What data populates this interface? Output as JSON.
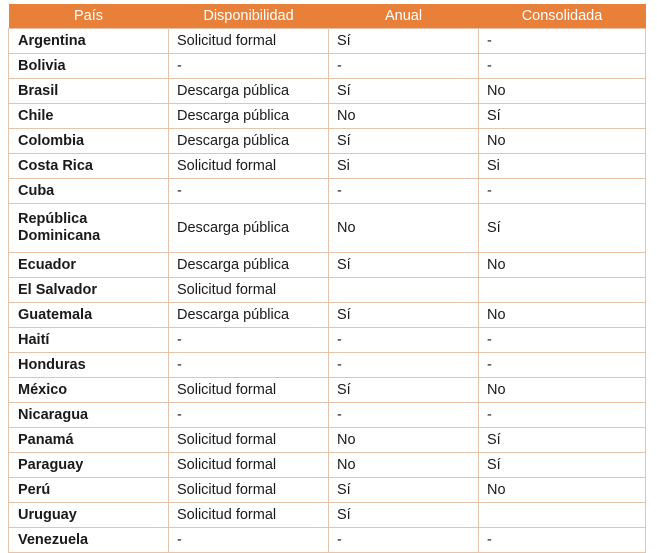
{
  "theme": {
    "header_bg": "#E8803A",
    "header_text": "#FFFFFF",
    "border": "#E6C3AB",
    "body_text": "#1A1A1A",
    "page_bg": "#FFFFFF"
  },
  "table": {
    "columns": [
      "País",
      "Disponibilidad",
      "Anual",
      "Consolidada"
    ],
    "rows": [
      {
        "pais": "Argentina",
        "disponibilidad": "Solicitud formal",
        "anual": "Sí",
        "consolidada": "-"
      },
      {
        "pais": "Bolivia",
        "disponibilidad": "-",
        "anual": "-",
        "consolidada": "-"
      },
      {
        "pais": "Brasil",
        "disponibilidad": "Descarga pública",
        "anual": "Sí",
        "consolidada": "No"
      },
      {
        "pais": "Chile",
        "disponibilidad": "Descarga pública",
        "anual": "No",
        "consolidada": "Sí"
      },
      {
        "pais": "Colombia",
        "disponibilidad": "Descarga pública",
        "anual": "Sí",
        "consolidada": "No"
      },
      {
        "pais": "Costa Rica",
        "disponibilidad": "Solicitud formal",
        "anual": "Si",
        "consolidada": "Si"
      },
      {
        "pais": "Cuba",
        "disponibilidad": "-",
        "anual": "-",
        "consolidada": "-"
      },
      {
        "pais": "República Dominicana",
        "disponibilidad": "Descarga pública",
        "anual": "No",
        "consolidada": "Sí",
        "tall": true
      },
      {
        "pais": "Ecuador",
        "disponibilidad": "Descarga pública",
        "anual": "Sí",
        "consolidada": "No"
      },
      {
        "pais": "El Salvador",
        "disponibilidad": "Solicitud formal",
        "anual": "",
        "consolidada": ""
      },
      {
        "pais": "Guatemala",
        "disponibilidad": "Descarga pública",
        "anual": "Sí",
        "consolidada": "No"
      },
      {
        "pais": "Haití",
        "disponibilidad": "-",
        "anual": "-",
        "consolidada": "-"
      },
      {
        "pais": "Honduras",
        "disponibilidad": "-",
        "anual": "-",
        "consolidada": "-"
      },
      {
        "pais": "México",
        "disponibilidad": "Solicitud formal",
        "anual": "Sí",
        "consolidada": "No"
      },
      {
        "pais": "Nicaragua",
        "disponibilidad": "-",
        "anual": "-",
        "consolidada": "-"
      },
      {
        "pais": "Panamá",
        "disponibilidad": "Solicitud formal",
        "anual": "No",
        "consolidada": "Sí"
      },
      {
        "pais": "Paraguay",
        "disponibilidad": "Solicitud formal",
        "anual": "No",
        "consolidada": "Sí"
      },
      {
        "pais": "Perú",
        "disponibilidad": "Solicitud formal",
        "anual": "Sí",
        "consolidada": "No"
      },
      {
        "pais": "Uruguay",
        "disponibilidad": "Solicitud formal",
        "anual": "Sí",
        "consolidada": ""
      },
      {
        "pais": "Venezuela",
        "disponibilidad": "-",
        "anual": "-",
        "consolidada": "-"
      }
    ]
  }
}
